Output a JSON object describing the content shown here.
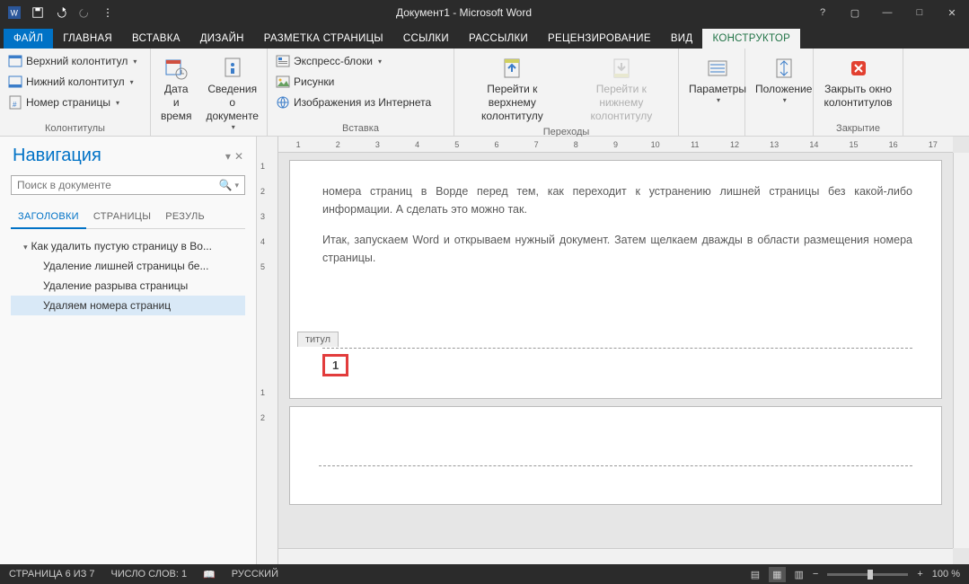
{
  "titlebar": {
    "title": "Документ1 - Microsoft Word"
  },
  "tabs": {
    "file": "ФАЙЛ",
    "items": [
      "ГЛАВНАЯ",
      "ВСТАВКА",
      "ДИЗАЙН",
      "РАЗМЕТКА СТРАНИЦЫ",
      "ССЫЛКИ",
      "РАССЫЛКИ",
      "РЕЦЕНЗИРОВАНИЕ",
      "ВИД",
      "КОНСТРУКТОР"
    ],
    "active_index": 8
  },
  "ribbon": {
    "group1": {
      "header": "Верхний колонтитул",
      "footer": "Нижний колонтитул",
      "pagenum": "Номер страницы",
      "label": "Колонтитулы"
    },
    "group2": {
      "date": "Дата и время",
      "docinfo": "Сведения о документе",
      "label": ""
    },
    "group3": {
      "quickparts": "Экспресс-блоки",
      "pictures": "Рисунки",
      "online": "Изображения из Интернета",
      "label": "Вставка"
    },
    "group4": {
      "gotoheader": "Перейти к верхнему колонтитулу",
      "gotofooter": "Перейти к нижнему колонтитулу",
      "label": "Переходы"
    },
    "group5": {
      "options": "Параметры",
      "label": ""
    },
    "group6": {
      "position": "Положение",
      "label": ""
    },
    "group7": {
      "close": "Закрыть окно колонтитулов",
      "label": "Закрытие"
    }
  },
  "nav": {
    "title": "Навигация",
    "search_placeholder": "Поиск в документе",
    "tabs": [
      "ЗАГОЛОВКИ",
      "СТРАНИЦЫ",
      "РЕЗУЛЬ"
    ],
    "active_tab": 0,
    "items": [
      {
        "level": 1,
        "text": "Как удалить пустую страницу в Во..."
      },
      {
        "level": 2,
        "text": "Удаление лишней страницы бе..."
      },
      {
        "level": 2,
        "text": "Удаление разрыва страницы"
      },
      {
        "level": 2,
        "text": "Удаляем номера страниц",
        "selected": true
      }
    ]
  },
  "document": {
    "para1": "номера страниц в Ворде перед тем, как переходит к устранению лишней страницы без какой-либо информации. А сделать это можно так.",
    "para2": "Итак, запускаем Word и открываем нужный документ. Затем щелкаем дважды в области размещения номера страницы.",
    "footer_tab": "титул",
    "page_number": "1"
  },
  "ruler_h": [
    "1",
    "2",
    "3",
    "4",
    "5",
    "6",
    "7",
    "8",
    "9",
    "10",
    "11",
    "12",
    "13",
    "14",
    "15",
    "16",
    "17"
  ],
  "ruler_v": [
    "1",
    "2",
    "3",
    "4",
    "5",
    "",
    "",
    "1",
    "2"
  ],
  "status": {
    "page": "СТРАНИЦА 6 ИЗ 7",
    "words": "ЧИСЛО СЛОВ: 1",
    "lang": "РУССКИЙ",
    "zoom": "100 %"
  }
}
